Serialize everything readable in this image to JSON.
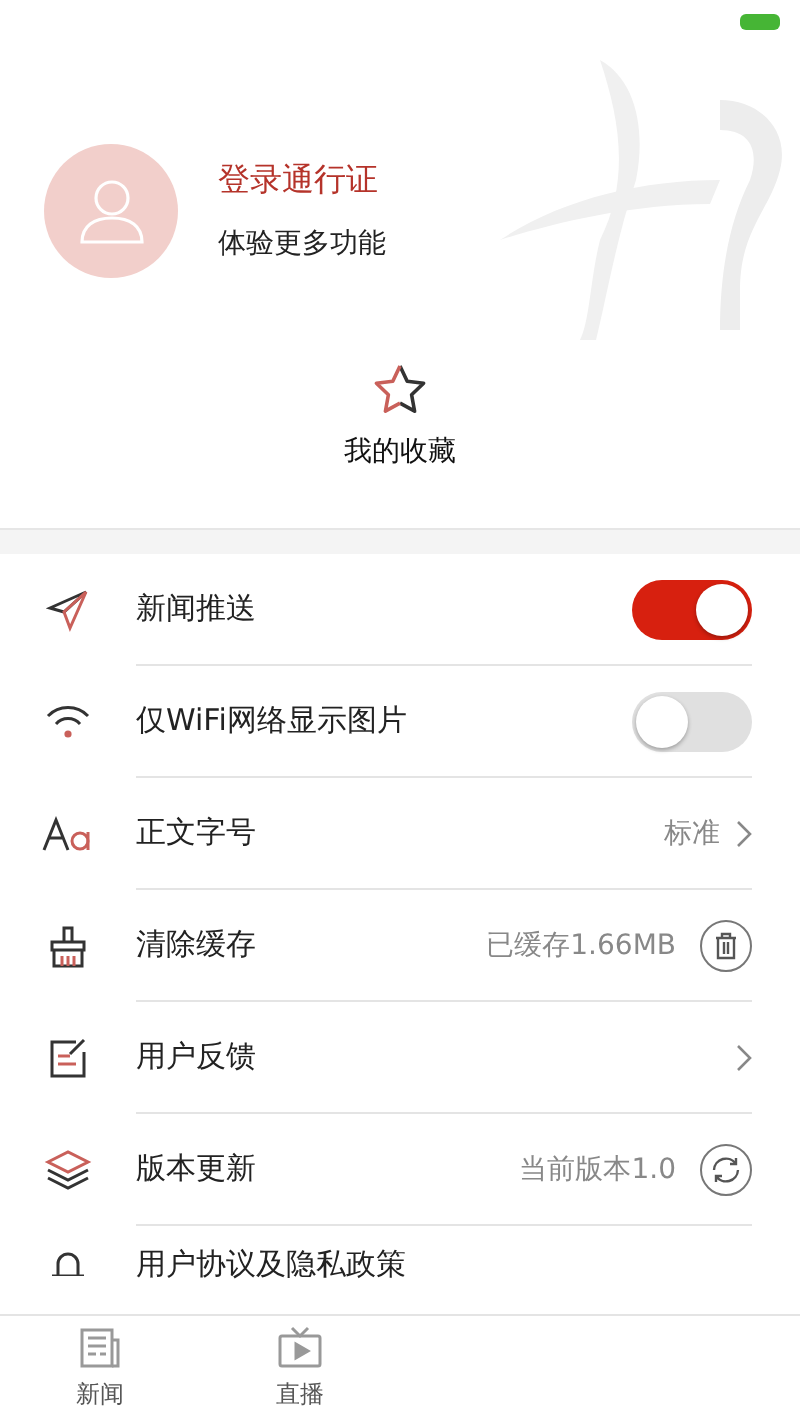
{
  "profile": {
    "title": "登录通行证",
    "subtitle": "体验更多功能"
  },
  "favorites": {
    "label": "我的收藏"
  },
  "settings": [
    {
      "kind": "toggle",
      "label": "新闻推送",
      "on": true
    },
    {
      "kind": "toggle",
      "label": "仅WiFi网络显示图片",
      "on": false
    },
    {
      "kind": "link",
      "label": "正文字号",
      "value": "标准"
    },
    {
      "kind": "action",
      "label": "清除缓存",
      "value": "已缓存1.66MB"
    },
    {
      "kind": "link",
      "label": "用户反馈"
    },
    {
      "kind": "action",
      "label": "版本更新",
      "value": "当前版本1.0"
    },
    {
      "kind": "plain",
      "label": "用户协议及隐私政策"
    }
  ],
  "tabs": [
    {
      "label": "新闻",
      "selected": false
    },
    {
      "label": "直播",
      "selected": false
    }
  ]
}
